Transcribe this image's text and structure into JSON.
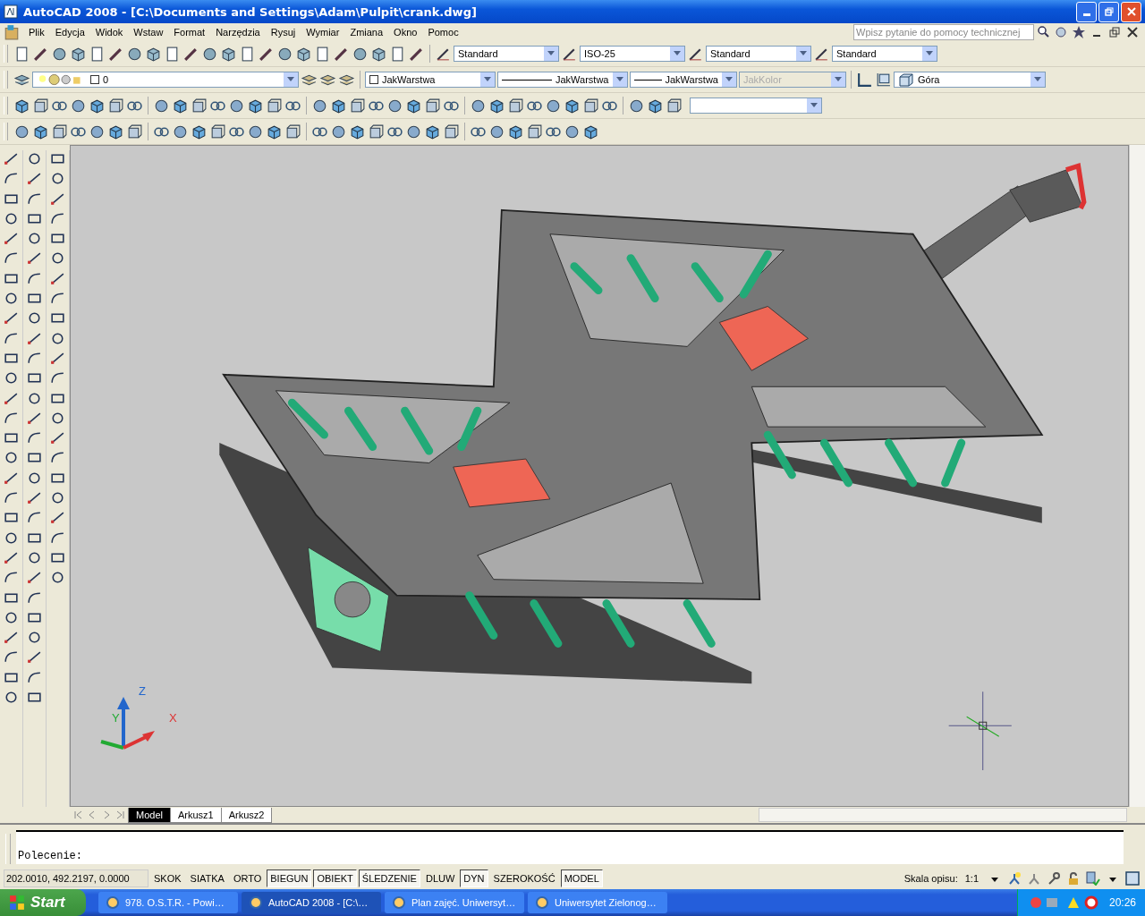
{
  "window": {
    "title": "AutoCAD 2008 - [C:\\Documents and Settings\\Adam\\Pulpit\\crank.dwg]"
  },
  "menu": [
    "Plik",
    "Edycja",
    "Widok",
    "Wstaw",
    "Format",
    "Narzędzia",
    "Rysuj",
    "Wymiar",
    "Zmiana",
    "Okno",
    "Pomoc"
  ],
  "help_search": {
    "placeholder": "Wpisz pytanie do pomocy technicznej"
  },
  "styles_toolbar": [
    {
      "value": "Standard"
    },
    {
      "value": "ISO-25"
    },
    {
      "value": "Standard"
    },
    {
      "value": "Standard"
    }
  ],
  "properties_toolbar": {
    "layer": "0",
    "color_setting": "JakWarstwa",
    "linetype": "JakWarstwa",
    "lineweight": "JakWarstwa",
    "plot_style": {
      "value": "JakKolor",
      "disabled": true
    },
    "view": "Góra"
  },
  "ucs_icon": {
    "z": "Z",
    "y": "Y",
    "x": "X"
  },
  "layout_tabs": [
    {
      "label": "Model",
      "selected": true
    },
    {
      "label": "Arkusz1",
      "selected": false
    },
    {
      "label": "Arkusz2",
      "selected": false
    }
  ],
  "command_line": {
    "prompt": "Polecenie:"
  },
  "status_bar": {
    "coordinates": "202.0010, 492.2197, 0.0000",
    "toggles": [
      {
        "label": "SKOK",
        "on": false
      },
      {
        "label": "SIATKA",
        "on": false
      },
      {
        "label": "ORTO",
        "on": false
      },
      {
        "label": "BIEGUN",
        "on": true
      },
      {
        "label": "OBIEKT",
        "on": true
      },
      {
        "label": "ŚLEDZENIE",
        "on": true
      },
      {
        "label": "DLUW",
        "on": false
      },
      {
        "label": "DYN",
        "on": true
      },
      {
        "label": "SZEROKOŚĆ",
        "on": false
      },
      {
        "label": "MODEL",
        "on": true
      }
    ],
    "annotation_scale_label": "Skala opisu:",
    "annotation_scale": "1:1"
  },
  "taskbar": {
    "start": "Start",
    "tasks": [
      {
        "label": "978. O.S.T.R. - Powi…",
        "selected": false
      },
      {
        "label": "AutoCAD 2008 - [C:\\…",
        "selected": true
      },
      {
        "label": "Plan zajęć. Uniwersyt…",
        "selected": false
      },
      {
        "label": "Uniwersytet Zielonog…",
        "selected": false
      }
    ],
    "clock": "20:26"
  }
}
